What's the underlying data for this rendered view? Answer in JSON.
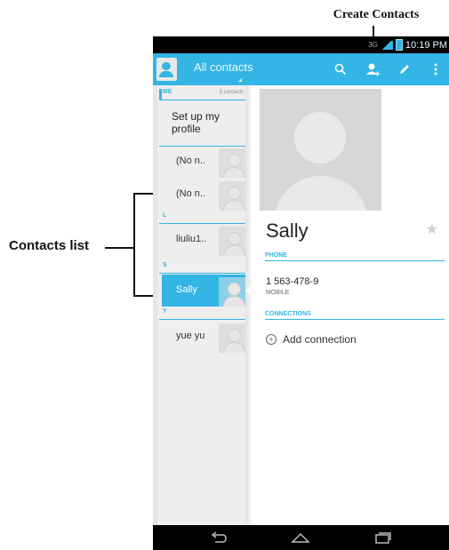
{
  "callouts": {
    "create_contacts": "Create Contacts",
    "contacts_list": "Contacts list"
  },
  "status_bar": {
    "network": "3G",
    "time": "10:19 PM"
  },
  "action_bar": {
    "title": "All contacts",
    "icons": [
      "app-contacts-icon",
      "search-icon",
      "add-contact-icon",
      "edit-icon",
      "overflow-menu-icon"
    ]
  },
  "contacts_list": {
    "me_header": "ME",
    "me_count": "5 contacts",
    "profile_label": "Set up my profile",
    "items": [
      {
        "name": "(No n.."
      },
      {
        "name": "(No n.."
      },
      {
        "name": "liuliu1.."
      },
      {
        "name": "Sally"
      },
      {
        "name": "yue yu"
      }
    ],
    "section_headers": [
      "L",
      "S",
      "Y"
    ]
  },
  "detail": {
    "name": "Sally",
    "phone_section": "PHONE",
    "phone_number": "1 563-478-9",
    "phone_type": "MOBILE",
    "connections_section": "CONNECTIONS",
    "add_connection_label": "Add connection"
  },
  "colors": {
    "accent": "#33b5e5",
    "background": "#ffffff",
    "list_background": "#eeeeee"
  }
}
